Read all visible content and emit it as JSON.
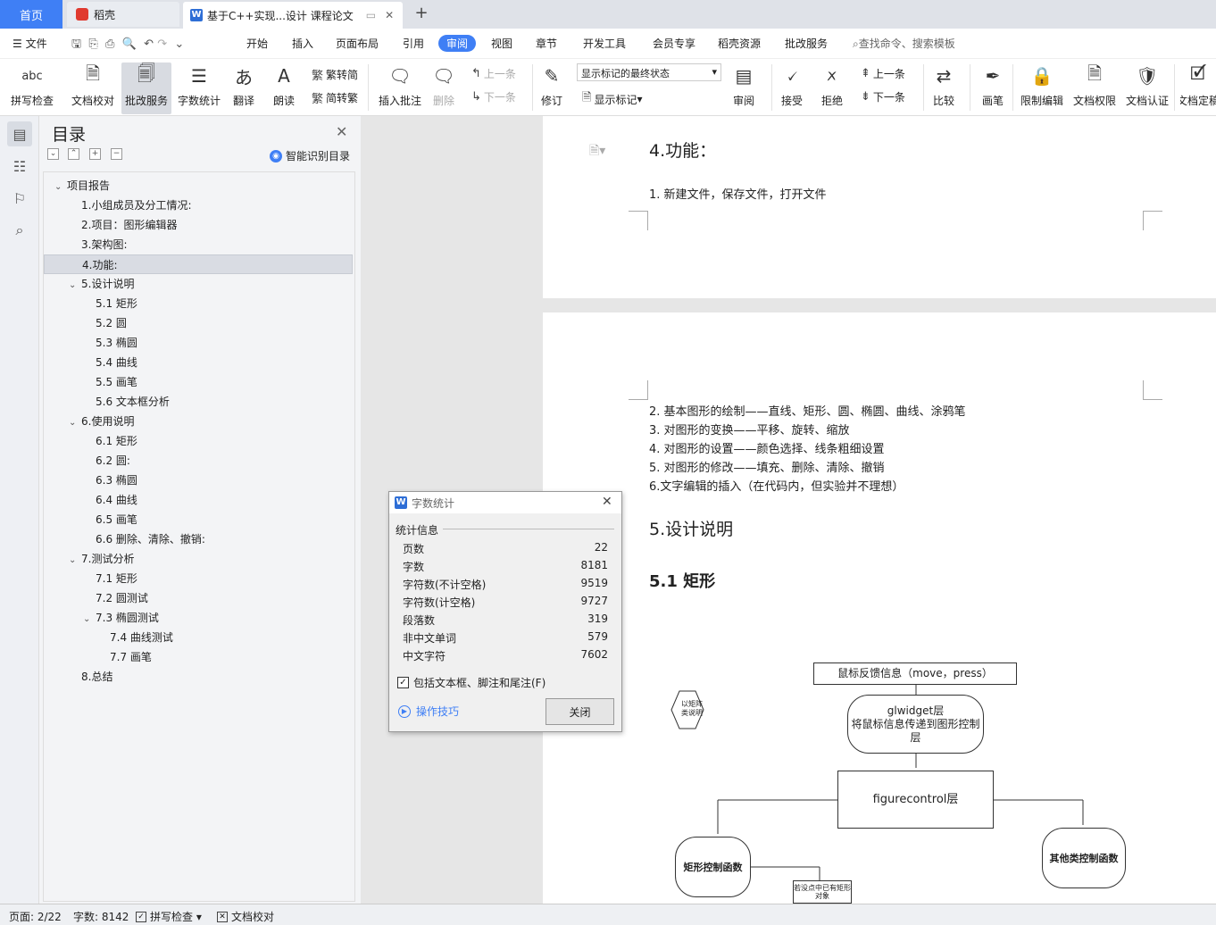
{
  "tabs": {
    "home": "首页",
    "daoke": "稻壳",
    "doc": "基于C++实现...设计 课程论文"
  },
  "menu": {
    "file": "文件",
    "items": [
      "开始",
      "插入",
      "页面布局",
      "引用",
      "审阅",
      "视图",
      "章节",
      "开发工具",
      "会员专享",
      "稻壳资源",
      "批改服务"
    ],
    "active": "审阅",
    "search": "查找命令、搜索模板"
  },
  "ribbon": {
    "spell": "拼写检查",
    "proof": "文档校对",
    "review_service": "批改服务",
    "wordcount": "字数统计",
    "translate": "翻译",
    "read": "朗读",
    "trad": "繁转简",
    "simp": "简转繁",
    "insert_comment": "插入批注",
    "delete": "删除",
    "prev": "上一条",
    "next": "下一条",
    "track": "修订",
    "markup_state": "显示标记的最终状态",
    "show_markup": "显示标记",
    "review": "审阅",
    "accept": "接受",
    "reject": "拒绝",
    "prev2": "上一条",
    "next2": "下一条",
    "compare": "比较",
    "pen": "画笔",
    "restrict": "限制编辑",
    "permission": "文档权限",
    "certify": "文档认证",
    "final": "文档定稿"
  },
  "toc": {
    "title": "目录",
    "smart": "智能识别目录",
    "items": [
      {
        "label": "项目报告",
        "level": 0,
        "toggle": "﹀"
      },
      {
        "label": "1.小组成员及分工情况:",
        "level": 1
      },
      {
        "label": "2.项目：图形编辑器",
        "level": 1
      },
      {
        "label": "3.架构图:",
        "level": 1
      },
      {
        "label": "4.功能:",
        "level": 1,
        "selected": true
      },
      {
        "label": "5.设计说明",
        "level": 1,
        "toggle": "﹀"
      },
      {
        "label": "5.1  矩形",
        "level": 2
      },
      {
        "label": "5.2  圆",
        "level": 2
      },
      {
        "label": "5.3  椭圆",
        "level": 2
      },
      {
        "label": "5.4 曲线",
        "level": 2
      },
      {
        "label": "5.5 画笔",
        "level": 2
      },
      {
        "label": "5.6 文本框分析",
        "level": 2
      },
      {
        "label": "6.使用说明",
        "level": 1,
        "toggle": "﹀"
      },
      {
        "label": "6.1  矩形",
        "level": 2
      },
      {
        "label": "6.2 圆:",
        "level": 2
      },
      {
        "label": "6.3 椭圆",
        "level": 2
      },
      {
        "label": "6.4 曲线",
        "level": 2
      },
      {
        "label": "6.5 画笔",
        "level": 2
      },
      {
        "label": "6.6 删除、清除、撤销:",
        "level": 2
      },
      {
        "label": "7.测试分析",
        "level": 1,
        "toggle": "﹀"
      },
      {
        "label": "7.1  矩形",
        "level": 2
      },
      {
        "label": "7.2 圆测试",
        "level": 2
      },
      {
        "label": "7.3 椭圆测试",
        "level": 2,
        "toggle": "﹀"
      },
      {
        "label": "7.4 曲线测试",
        "level": 3
      },
      {
        "label": "7.7 画笔",
        "level": 3
      },
      {
        "label": "8.总结",
        "level": 1
      }
    ]
  },
  "doc": {
    "p1_heading": "4.功能：",
    "p1_item1": "1.   新建文件，保存文件，打开文件",
    "items": [
      "2.   基本图形的绘制——直线、矩形、圆、椭圆、曲线、涂鸦笔",
      "3.   对图形的变换——平移、旋转、缩放",
      "4.   对图形的设置——颜色选择、线条粗细设置",
      "5.   对图形的修改——填充、删除、清除、撤销",
      "6.文字编辑的插入（在代码内，但实验并不理想）"
    ],
    "h_design": "5.设计说明",
    "h_rect": "5.1  矩形",
    "diagram": {
      "mouse": "鼠标反馈信息（move，press）",
      "hex": "以矩阵类说明",
      "glw1": "glwidget层",
      "glw2": "将鼠标信息传递到图形控制层",
      "figure": "figurecontrol层",
      "rect": "矩形控制函数",
      "other": "其他类控制函数",
      "note": "若没点中已有矩形对象"
    }
  },
  "dialog": {
    "title": "字数统计",
    "group": "统计信息",
    "rows": [
      {
        "k": "页数",
        "v": "22"
      },
      {
        "k": "字数",
        "v": "8181"
      },
      {
        "k": "字符数(不计空格)",
        "v": "9519"
      },
      {
        "k": "字符数(计空格)",
        "v": "9727"
      },
      {
        "k": "段落数",
        "v": "319"
      },
      {
        "k": "非中文单词",
        "v": "579"
      },
      {
        "k": "中文字符",
        "v": "7602"
      }
    ],
    "checkbox": "包括文本框、脚注和尾注(F)",
    "tips": "操作技巧",
    "close": "关闭"
  },
  "status": {
    "page": "页面: 2/22",
    "words": "字数: 8142",
    "spell": "拼写检查",
    "proof": "文档校对"
  }
}
